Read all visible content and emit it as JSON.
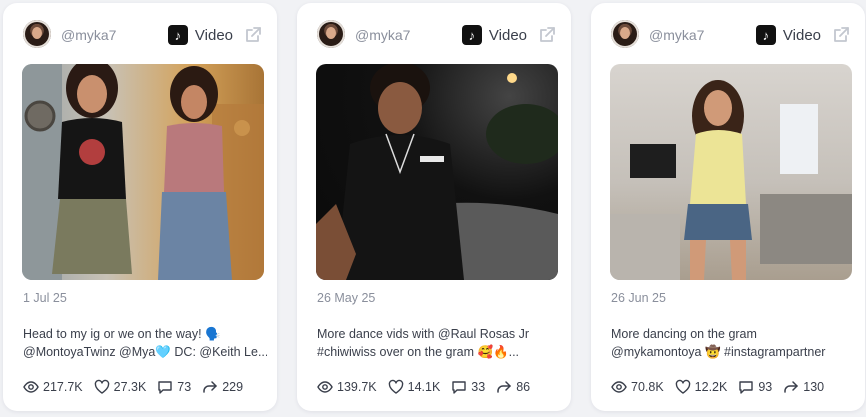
{
  "cards": [
    {
      "handle": "@myka7",
      "platform": "Video",
      "date": "1 Jul 25",
      "caption_line1": "Head to my ig or we on the way! 🗣️",
      "caption_line2": "@MontoyaTwinz @Mya🩵 DC: @Keith Le...",
      "views": "217.7K",
      "likes": "27.3K",
      "comments": "73",
      "shares": "229"
    },
    {
      "handle": "@myka7",
      "platform": "Video",
      "date": "26 May 25",
      "caption_line1": "More dance vids with @Raul Rosas Jr",
      "caption_line2": "#chiwiwiss over on the gram 🥰🔥...",
      "views": "139.7K",
      "likes": "14.1K",
      "comments": "33",
      "shares": "86"
    },
    {
      "handle": "@myka7",
      "platform": "Video",
      "date": "26 Jun 25",
      "caption_line1": "More dancing on the gram",
      "caption_line2": "@mykamontoya 🤠 #instagrampartner",
      "views": "70.8K",
      "likes": "12.2K",
      "comments": "93",
      "shares": "130"
    }
  ],
  "icons": {
    "platform": "tiktok-icon",
    "external": "external-link-icon",
    "views": "eye-icon",
    "likes": "heart-icon",
    "comments": "comment-icon",
    "shares": "share-icon"
  },
  "colors": {
    "background": "#f1f2f5",
    "card": "#ffffff",
    "muted_text": "#8a8f9c",
    "text": "#3a3f4b"
  }
}
